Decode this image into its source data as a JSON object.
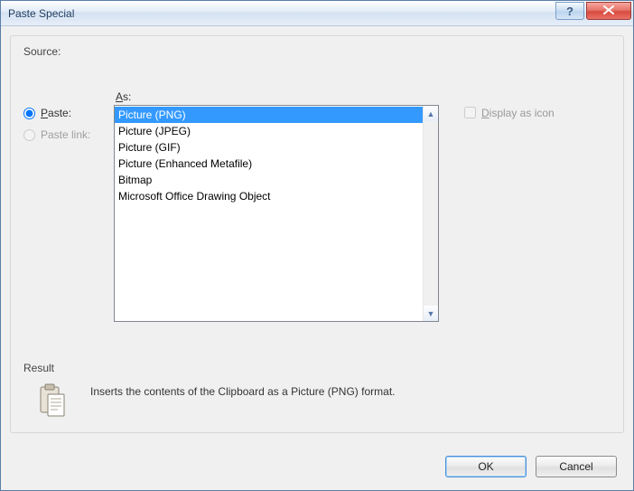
{
  "window": {
    "title": "Paste Special"
  },
  "source": {
    "label": "Source:",
    "value": ""
  },
  "radios": {
    "paste_label": "Paste:",
    "paste_link_label": "Paste link:"
  },
  "as": {
    "label": "As:",
    "items": [
      "Picture (PNG)",
      "Picture (JPEG)",
      "Picture (GIF)",
      "Picture (Enhanced Metafile)",
      "Bitmap",
      "Microsoft Office Drawing Object"
    ],
    "selected_index": 0
  },
  "display_as_icon": {
    "label": "Display as icon",
    "checked": false,
    "enabled": false
  },
  "result": {
    "label": "Result",
    "text": "Inserts the contents of the Clipboard as a Picture (PNG) format."
  },
  "buttons": {
    "ok": "OK",
    "cancel": "Cancel"
  }
}
